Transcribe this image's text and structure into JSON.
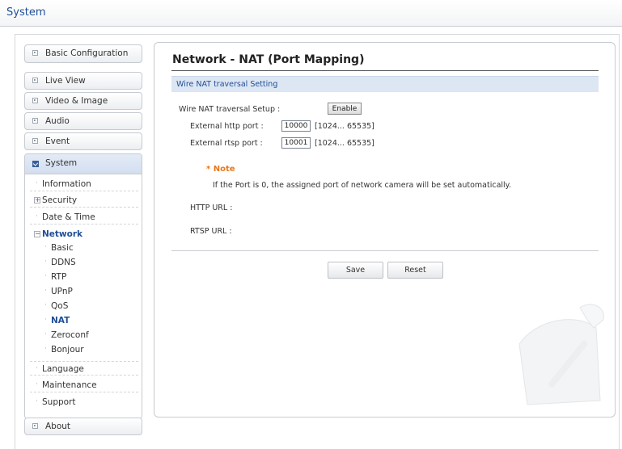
{
  "header": {
    "title": "System"
  },
  "sidebar": {
    "top_items": [
      {
        "label": "Basic Configuration"
      },
      {
        "label": "Live View"
      },
      {
        "label": "Video & Image"
      },
      {
        "label": "Audio"
      },
      {
        "label": "Event"
      }
    ],
    "system": {
      "label": "System",
      "items": [
        {
          "label": "Information"
        },
        {
          "label": "Security",
          "expand": "+"
        },
        {
          "label": "Date & Time"
        },
        {
          "label": "Network",
          "expand": "−"
        }
      ],
      "network_items": [
        {
          "label": "Basic"
        },
        {
          "label": "DDNS"
        },
        {
          "label": "RTP"
        },
        {
          "label": "UPnP"
        },
        {
          "label": "QoS"
        },
        {
          "label": "NAT"
        },
        {
          "label": "Zeroconf"
        },
        {
          "label": "Bonjour"
        }
      ],
      "after_items": [
        {
          "label": "Language"
        },
        {
          "label": "Maintenance"
        },
        {
          "label": "Support"
        }
      ]
    },
    "about": {
      "label": "About"
    }
  },
  "main": {
    "title": "Network - NAT (Port Mapping)",
    "section": "Wire NAT traversal Setting",
    "setup_label": "Wire NAT traversal Setup :",
    "enable_label": "Enable",
    "http_label": "External http port :",
    "http_value": "10000",
    "http_range": "[1024... 65535]",
    "rtsp_label": "External rtsp port :",
    "rtsp_value": "10001",
    "rtsp_range": "[1024... 65535]",
    "note_label": "* Note",
    "note_text": "If the Port is 0, the assigned port of network camera will be set automatically.",
    "http_url_label": "HTTP URL :",
    "rtsp_url_label": "RTSP URL :",
    "save_label": "Save",
    "reset_label": "Reset"
  }
}
